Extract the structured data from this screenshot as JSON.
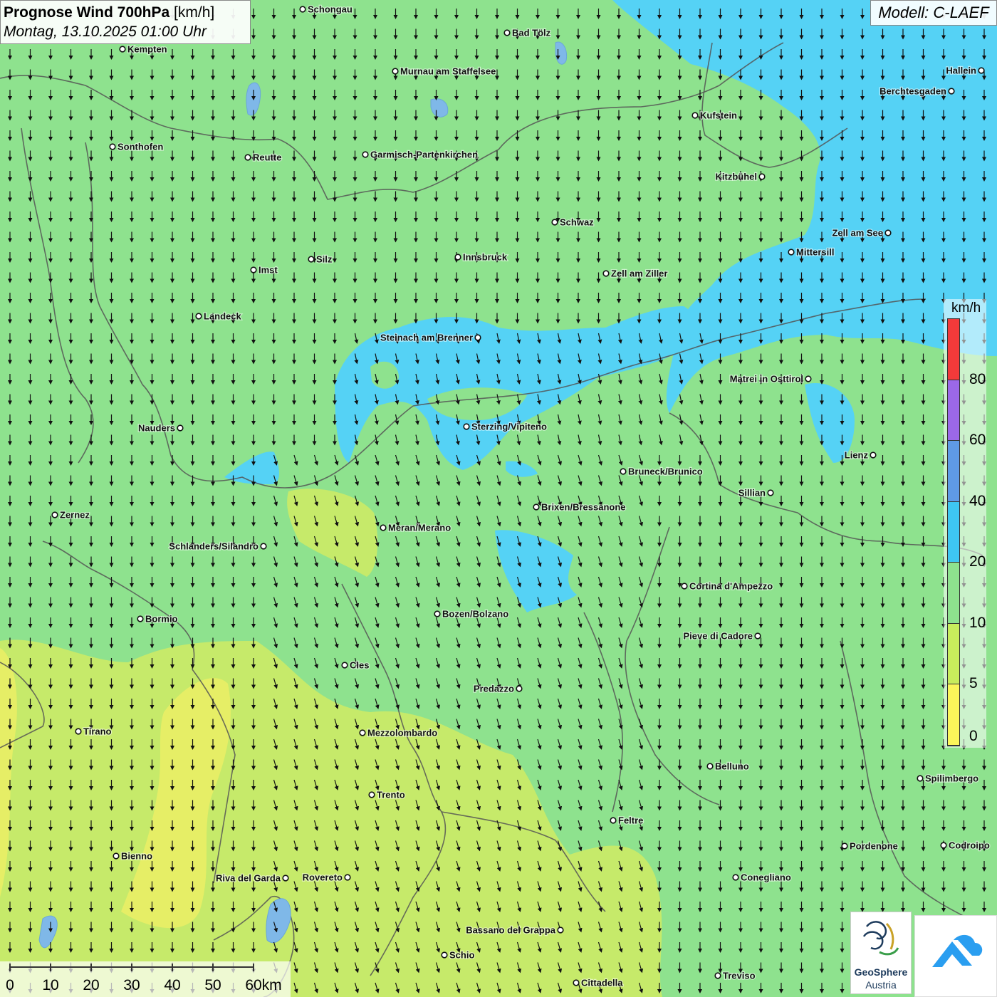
{
  "header": {
    "title_bold": "Prognose Wind 700hPa",
    "title_unit": "[km/h]",
    "datetime": "Montag, 13.10.2025 01:00 Uhr",
    "model": "Modell: C-LAEF"
  },
  "legend": {
    "unit": "km/h",
    "ticks": [
      "0",
      "5",
      "10",
      "20",
      "40",
      "60",
      "80"
    ],
    "colors": [
      "#fbf55a",
      "#c8ec5c",
      "#8ee28e",
      "#3ec6f2",
      "#5f9ae6",
      "#9b68e8",
      "#f23a3a"
    ]
  },
  "scale_bar": {
    "labels": [
      "0",
      "10",
      "20",
      "30",
      "40",
      "50",
      "60km"
    ]
  },
  "logos": {
    "geosphere_line1": "GeoSphere",
    "geosphere_line2": "Austria"
  },
  "colors": {
    "calm_yellow": "#e6ee66",
    "light_green": "#c8ec5c",
    "green": "#8ee28e",
    "blue": "#55d2f5",
    "arrow": "#111111",
    "border": "#555555"
  },
  "wind": {
    "dominant_direction": "north-to-south",
    "arrow_icon": "down-arrow-icon"
  },
  "cities": [
    {
      "name": "Schongau"
    },
    {
      "name": "Bad Tölz"
    },
    {
      "name": "Kempten"
    },
    {
      "name": "Murnau am Staffelsee"
    },
    {
      "name": "Hallein"
    },
    {
      "name": "Berchtesgaden"
    },
    {
      "name": "Kufstein"
    },
    {
      "name": "Sonthofen"
    },
    {
      "name": "Reutte"
    },
    {
      "name": "Garmisch-Partenkirchen"
    },
    {
      "name": "Kitzbühel"
    },
    {
      "name": "Schwaz"
    },
    {
      "name": "Zell am See"
    },
    {
      "name": "Mittersill"
    },
    {
      "name": "Silz"
    },
    {
      "name": "Innsbruck"
    },
    {
      "name": "Imst"
    },
    {
      "name": "Zell am Ziller"
    },
    {
      "name": "Landeck"
    },
    {
      "name": "Steinach am Brenner"
    },
    {
      "name": "Matrei in Osttirol"
    },
    {
      "name": "Nauders"
    },
    {
      "name": "Sterzing/Vipiteno"
    },
    {
      "name": "Lienz"
    },
    {
      "name": "Bruneck/Brunico"
    },
    {
      "name": "Sillian"
    },
    {
      "name": "Zernez"
    },
    {
      "name": "Brixen/Bressanone"
    },
    {
      "name": "Meran/Merano"
    },
    {
      "name": "Schlanders/Silandro"
    },
    {
      "name": "Cortina d'Ampezzo"
    },
    {
      "name": "Bozen/Bolzano"
    },
    {
      "name": "Bormio"
    },
    {
      "name": "Pieve di Cadore"
    },
    {
      "name": "Cles"
    },
    {
      "name": "Predazzo"
    },
    {
      "name": "Tirano"
    },
    {
      "name": "Mezzolombardo"
    },
    {
      "name": "Belluno"
    },
    {
      "name": "Spilimbergo"
    },
    {
      "name": "Trento"
    },
    {
      "name": "Feltre"
    },
    {
      "name": "Pordenone"
    },
    {
      "name": "Codroipo"
    },
    {
      "name": "Bienno"
    },
    {
      "name": "Riva del Garda"
    },
    {
      "name": "Rovereto"
    },
    {
      "name": "Conegliano"
    },
    {
      "name": "Bassano del Grappa"
    },
    {
      "name": "Schio"
    },
    {
      "name": "Treviso"
    },
    {
      "name": "Cittadella"
    }
  ]
}
